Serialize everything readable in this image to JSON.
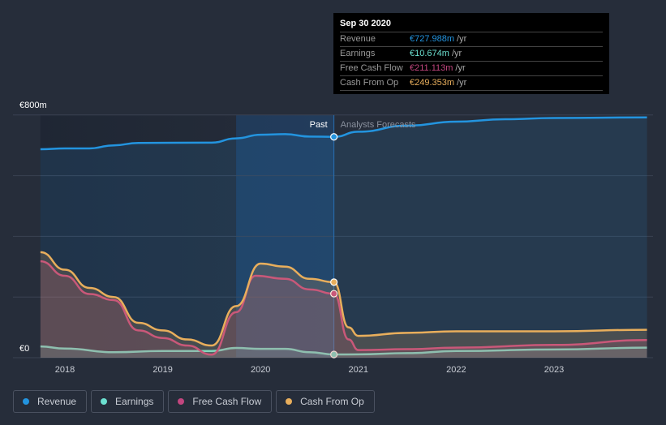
{
  "chart_data": {
    "type": "area",
    "ylim": [
      0,
      800
    ],
    "y_tick_labels": [
      "€0",
      "€800m"
    ],
    "x_tick_labels": [
      "2018",
      "2019",
      "2020",
      "2021",
      "2022",
      "2023"
    ],
    "xlim": [
      2017.75,
      2023.95
    ],
    "grid": true,
    "past_label": "Past",
    "forecast_label": "Analysts Forecasts",
    "divider_x": 2020.75,
    "legend_placement": "bottom-left",
    "series": [
      {
        "name": "Revenue",
        "color": "#2394df",
        "x": [
          2017.75,
          2018,
          2018.25,
          2018.5,
          2018.75,
          2019.5,
          2019.75,
          2020,
          2020.25,
          2020.5,
          2020.75,
          2021,
          2021.5,
          2022,
          2022.5,
          2023,
          2023.95
        ],
        "values": [
          687,
          690,
          690,
          700,
          708,
          709,
          723,
          735,
          737,
          729,
          728,
          745,
          765,
          778,
          786,
          790,
          792
        ]
      },
      {
        "name": "Earnings",
        "color": "#6ce0d0",
        "x": [
          2017.75,
          2018,
          2018.5,
          2019,
          2019.5,
          2019.75,
          2020,
          2020.25,
          2020.5,
          2020.75,
          2021,
          2021.5,
          2022,
          2023,
          2023.95
        ],
        "values": [
          37,
          30,
          18,
          22,
          22,
          32,
          29,
          29,
          18,
          10.7,
          11,
          15,
          22,
          27,
          33
        ]
      },
      {
        "name": "Free Cash Flow",
        "color": "#c2467f",
        "x": [
          2017.75,
          2018,
          2018.25,
          2018.5,
          2018.75,
          2019,
          2019.25,
          2019.5,
          2019.75,
          2019.95,
          2020.25,
          2020.5,
          2020.75,
          2020.9,
          2021,
          2021.5,
          2022,
          2023,
          2023.95
        ],
        "values": [
          318,
          270,
          210,
          190,
          90,
          65,
          40,
          10,
          150,
          270,
          260,
          225,
          211,
          60,
          25,
          28,
          33,
          42,
          58
        ]
      },
      {
        "name": "Cash From Op",
        "color": "#e8ae5c",
        "x": [
          2017.75,
          2018,
          2018.25,
          2018.5,
          2018.75,
          2019,
          2019.25,
          2019.5,
          2019.75,
          2020,
          2020.25,
          2020.5,
          2020.75,
          2020.9,
          2021,
          2021.5,
          2022,
          2023,
          2023.95
        ],
        "values": [
          348,
          290,
          230,
          200,
          115,
          90,
          60,
          40,
          170,
          310,
          300,
          260,
          249,
          100,
          72,
          82,
          87,
          87,
          92
        ]
      }
    ]
  },
  "tooltip": {
    "title": "Sep 30 2020",
    "rows": [
      {
        "label": "Revenue",
        "value": "€727.988m",
        "unit": "/yr",
        "color": "#2394df"
      },
      {
        "label": "Earnings",
        "value": "€10.674m",
        "unit": "/yr",
        "color": "#6ce0d0"
      },
      {
        "label": "Free Cash Flow",
        "value": "€211.113m",
        "unit": "/yr",
        "color": "#c2467f"
      },
      {
        "label": "Cash From Op",
        "value": "€249.353m",
        "unit": "/yr",
        "color": "#e8ae5c"
      }
    ]
  },
  "legend": [
    "Revenue",
    "Earnings",
    "Free Cash Flow",
    "Cash From Op"
  ]
}
